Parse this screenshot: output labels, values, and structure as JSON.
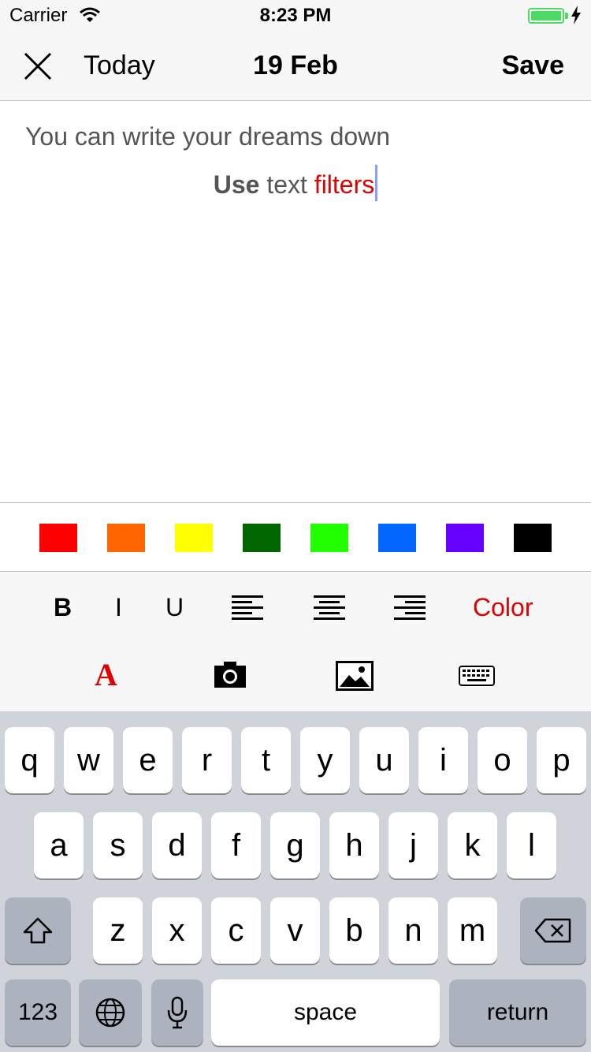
{
  "status_bar": {
    "carrier": "Carrier",
    "time": "8:23 PM",
    "battery_level": 1.0
  },
  "nav": {
    "close_icon": "close-icon",
    "left_label": "Today",
    "title": "19 Feb",
    "save_label": "Save"
  },
  "editor": {
    "line1": "You can write your dreams down",
    "line2_bold": "Use",
    "line2_plain": " text ",
    "line2_red": "filters"
  },
  "palette": {
    "colors": [
      "#ff0000",
      "#ff6600",
      "#ffff00",
      "#006600",
      "#22ff00",
      "#0066ff",
      "#6600ff",
      "#000000"
    ]
  },
  "format_bar": {
    "bold_label": "B",
    "italic_label": "I",
    "underline_label": "U",
    "color_label": "Color",
    "font_label": "A",
    "icons": [
      "align-left-icon",
      "align-center-icon",
      "align-right-icon",
      "font-color-icon",
      "camera-icon",
      "photo-icon",
      "keyboard-icon"
    ]
  },
  "keyboard": {
    "row1": [
      "q",
      "w",
      "e",
      "r",
      "t",
      "y",
      "u",
      "i",
      "o",
      "p"
    ],
    "row2": [
      "a",
      "s",
      "d",
      "f",
      "g",
      "h",
      "j",
      "k",
      "l"
    ],
    "row3": [
      "z",
      "x",
      "c",
      "v",
      "b",
      "n",
      "m"
    ],
    "numbers_label": "123",
    "space_label": "space",
    "return_label": "return"
  },
  "accent_colors": {
    "red": "#e00000",
    "battery_green": "#4cd964",
    "caret": "#8aa0f0"
  }
}
